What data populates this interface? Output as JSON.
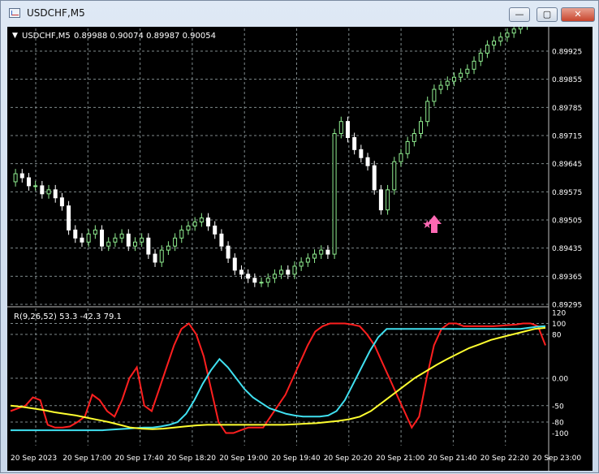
{
  "window": {
    "title": "USDCHF,M5",
    "buttons": {
      "minimize": "—",
      "maximize": "▢",
      "close": "✕"
    }
  },
  "main_chart": {
    "symbol_label": "USDCHF,M5",
    "ohlc": "0.89988 0.90074 0.89987 0.90054",
    "price_labels": [
      "0.89925",
      "0.89855",
      "0.89785",
      "0.89715",
      "0.89645",
      "0.89575",
      "0.89505",
      "0.89435",
      "0.89365",
      "0.89295"
    ]
  },
  "indicator": {
    "label": "R(9,26,52) 53.3 -42.3 79.1",
    "scale_labels": [
      "120",
      "100",
      "80",
      "0.00",
      "-50",
      "-80",
      "-100"
    ]
  },
  "time_axis": [
    "20 Sep 2023",
    "20 Sep 17:00",
    "20 Sep 17:40",
    "20 Sep 18:20",
    "20 Sep 19:00",
    "20 Sep 19:40",
    "20 Sep 20:20",
    "20 Sep 21:00",
    "20 Sep 21:40",
    "20 Sep 22:20",
    "20 Sep 23:00"
  ],
  "colors": {
    "bull": "#90ee90",
    "bear": "#ffffff",
    "red_line": "#ff1f1f",
    "cyan_line": "#40e0f0",
    "yellow_line": "#ffff30",
    "arrow": "#ff69b4",
    "grid": "#7f8a8c",
    "text": "#ffffff"
  },
  "chart_data": [
    {
      "type": "candlestick",
      "symbol": "USDCHF",
      "timeframe": "M5",
      "ylim": [
        0.89295,
        0.89925
      ],
      "x": [
        "16:25",
        "16:30",
        "16:35",
        "16:40",
        "16:45",
        "16:50",
        "16:55",
        "17:00",
        "17:05",
        "17:10",
        "17:15",
        "17:20",
        "17:25",
        "17:30",
        "17:35",
        "17:40",
        "17:45",
        "17:50",
        "17:55",
        "18:00",
        "18:05",
        "18:10",
        "18:15",
        "18:20",
        "18:25",
        "18:30",
        "18:35",
        "18:40",
        "18:45",
        "18:50",
        "18:55",
        "19:00",
        "19:05",
        "19:10",
        "19:15",
        "19:20",
        "19:25",
        "19:30",
        "19:35",
        "19:40",
        "19:45",
        "19:50",
        "19:55",
        "20:00",
        "20:05",
        "20:10",
        "20:15",
        "20:20",
        "20:25",
        "20:30",
        "20:35",
        "20:40",
        "20:45",
        "20:50",
        "20:55",
        "21:00",
        "21:05",
        "21:10",
        "21:15",
        "21:20",
        "21:25",
        "21:30",
        "21:35",
        "21:40",
        "21:45",
        "21:50",
        "21:55",
        "22:00",
        "22:05",
        "22:10",
        "22:15",
        "22:20",
        "22:25",
        "22:30",
        "22:35",
        "22:40",
        "22:45",
        "22:50",
        "22:55",
        "23:00"
      ],
      "close": [
        0.8962,
        0.8961,
        0.8959,
        0.8959,
        0.8957,
        0.8958,
        0.8956,
        0.8954,
        0.8948,
        0.8946,
        0.8945,
        0.8947,
        0.8948,
        0.8944,
        0.8945,
        0.8946,
        0.8947,
        0.8944,
        0.8945,
        0.8946,
        0.8942,
        0.894,
        0.8943,
        0.8944,
        0.8946,
        0.8948,
        0.8949,
        0.895,
        0.8951,
        0.8949,
        0.8947,
        0.8944,
        0.8941,
        0.8938,
        0.8937,
        0.8936,
        0.8935,
        0.8935,
        0.8936,
        0.8937,
        0.8938,
        0.8937,
        0.8939,
        0.894,
        0.8941,
        0.8942,
        0.8943,
        0.8942,
        0.8972,
        0.8975,
        0.8971,
        0.8968,
        0.8966,
        0.8964,
        0.8958,
        0.8953,
        0.8958,
        0.8965,
        0.8967,
        0.897,
        0.8972,
        0.8975,
        0.898,
        0.8983,
        0.8984,
        0.8985,
        0.8986,
        0.8987,
        0.8988,
        0.899,
        0.8992,
        0.8994,
        0.8995,
        0.8996,
        0.8997,
        0.8998,
        0.8999,
        0.9,
        0.9001,
        0.9005
      ]
    },
    {
      "type": "line",
      "series": [
        {
          "name": "R(9,26,52)",
          "color": "#ff1f1f",
          "values": [
            -60,
            -55,
            -50,
            -35,
            -40,
            -85,
            -90,
            -90,
            -88,
            -80,
            -70,
            -30,
            -40,
            -60,
            -70,
            -40,
            0,
            20,
            -50,
            -60,
            -20,
            20,
            60,
            90,
            100,
            80,
            40,
            -20,
            -80,
            -100,
            -100,
            -95,
            -90,
            -90,
            -90,
            -70,
            -50,
            -30,
            0,
            30,
            60,
            85,
            95,
            100,
            100,
            100,
            98,
            95,
            80,
            60,
            30,
            0,
            -30,
            -60,
            -90,
            -70,
            0,
            60,
            90,
            100,
            100,
            95,
            95,
            95,
            95,
            95,
            96,
            97,
            98,
            100,
            100,
            95,
            60
          ]
        },
        {
          "color": "#40e0f0",
          "values": [
            -95,
            -95,
            -95,
            -95,
            -95,
            -95,
            -95,
            -95,
            -95,
            -95,
            -95,
            -95,
            -94,
            -93,
            -92,
            -91,
            -90,
            -90,
            -88,
            -85,
            -80,
            -65,
            -40,
            -10,
            15,
            35,
            20,
            0,
            -20,
            -35,
            -45,
            -55,
            -60,
            -65,
            -68,
            -70,
            -70,
            -70,
            -68,
            -60,
            -40,
            -10,
            20,
            50,
            75,
            90,
            90,
            90,
            90,
            90,
            90,
            90,
            90,
            90,
            90,
            90,
            90,
            90,
            90,
            90,
            90,
            90,
            92,
            94,
            95
          ]
        },
        {
          "color": "#ffff30",
          "values": [
            -50,
            -52,
            -55,
            -58,
            -62,
            -65,
            -68,
            -72,
            -76,
            -80,
            -85,
            -90,
            -92,
            -93,
            -92,
            -90,
            -88,
            -86,
            -85,
            -85,
            -85,
            -85,
            -85,
            -85,
            -85,
            -85,
            -84,
            -83,
            -82,
            -80,
            -78,
            -75,
            -70,
            -60,
            -45,
            -30,
            -15,
            0,
            12,
            24,
            35,
            45,
            55,
            62,
            70,
            75,
            80,
            85,
            90,
            92
          ]
        }
      ],
      "ylim": [
        -120,
        120
      ]
    }
  ]
}
